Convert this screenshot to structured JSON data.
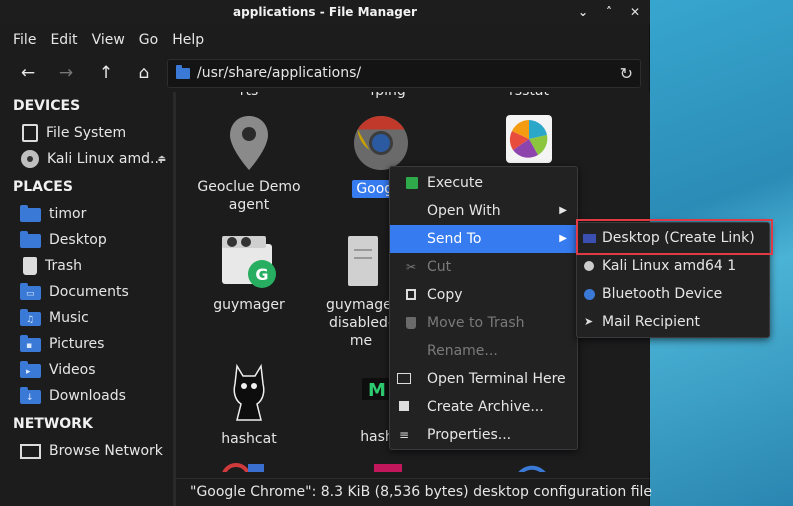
{
  "window": {
    "title": "applications - File Manager",
    "controls": [
      "⌄",
      "˄",
      "✕"
    ]
  },
  "menubar": [
    "File",
    "Edit",
    "View",
    "Go",
    "Help"
  ],
  "toolbar": {
    "back": "←",
    "forward": "→",
    "up": "↑",
    "home": "⌂",
    "path": "/usr/share/applications/",
    "reload": "↻"
  },
  "sidebar": {
    "devices_heading": "DEVICES",
    "devices": [
      {
        "label": "File System",
        "icon": "drive-icon"
      },
      {
        "label": "Kali Linux amd...",
        "icon": "disc-icon",
        "eject": "⏏"
      }
    ],
    "places_heading": "PLACES",
    "places": [
      {
        "label": "timor",
        "icon": "folder-home-icon",
        "glyph": ""
      },
      {
        "label": "Desktop",
        "icon": "folder-desktop-icon",
        "glyph": ""
      },
      {
        "label": "Trash",
        "icon": "trash-icon",
        "glyph": ""
      },
      {
        "label": "Documents",
        "icon": "folder-documents-icon",
        "glyph": "▭"
      },
      {
        "label": "Music",
        "icon": "folder-music-icon",
        "glyph": "♫"
      },
      {
        "label": "Pictures",
        "icon": "folder-pictures-icon",
        "glyph": "▪"
      },
      {
        "label": "Videos",
        "icon": "folder-videos-icon",
        "glyph": "▸"
      },
      {
        "label": "Downloads",
        "icon": "folder-downloads-icon",
        "glyph": "↓"
      }
    ],
    "network_heading": "NETWORK",
    "network": [
      {
        "label": "Browse Network",
        "icon": "network-icon"
      }
    ]
  },
  "files": {
    "top_partial": [
      "rts",
      "fping",
      "rsstat"
    ],
    "geoclue": [
      "Geoclue Demo",
      "agent"
    ],
    "google": "Google",
    "guymager": "guymager",
    "guymager_disabled": [
      "guymager-",
      "disabled-",
      "me"
    ],
    "hashcat": "hashcat",
    "hash": "hash"
  },
  "context_menu": {
    "items": [
      {
        "label": "Execute",
        "icon": "execute-icon",
        "state": "normal"
      },
      {
        "label": "Open With",
        "icon": "",
        "state": "normal",
        "submenu": true
      },
      {
        "label": "Send To",
        "icon": "",
        "state": "highlighted",
        "submenu": true
      },
      {
        "label": "Cut",
        "icon": "cut-icon",
        "state": "disabled"
      },
      {
        "label": "Copy",
        "icon": "copy-icon",
        "state": "normal"
      },
      {
        "label": "Move to Trash",
        "icon": "trash-icon",
        "state": "disabled"
      },
      {
        "label": "Rename...",
        "icon": "",
        "state": "disabled"
      },
      {
        "label": "Open Terminal Here",
        "icon": "terminal-icon",
        "state": "normal"
      },
      {
        "label": "Create Archive...",
        "icon": "archive-icon",
        "state": "normal"
      },
      {
        "label": "Properties...",
        "icon": "properties-icon",
        "state": "normal"
      }
    ],
    "arrow": "▶"
  },
  "send_to_menu": {
    "items": [
      {
        "label": "Desktop (Create Link)",
        "icon": "desktop-icon"
      },
      {
        "label": "Kali Linux amd64 1",
        "icon": "disc-icon"
      },
      {
        "label": "Bluetooth Device",
        "icon": "bluetooth-icon"
      },
      {
        "label": "Mail Recipient",
        "icon": "mail-icon"
      }
    ]
  },
  "status": "\"Google Chrome\": 8.3 KiB (8,536 bytes) desktop configuration file",
  "colors": {
    "accent": "#367bf0",
    "highlight_box": "#e03a45",
    "window_bg": "#1c1c1d",
    "folder": "#3a7ad6"
  }
}
